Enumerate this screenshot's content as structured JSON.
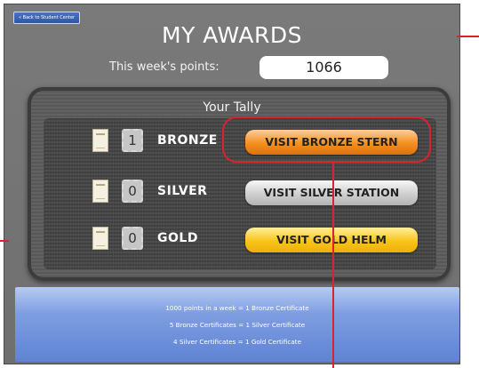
{
  "header": {
    "back_label": "« Back to Student Center",
    "title": "MY AWARDS"
  },
  "points": {
    "label": "This week's points:",
    "value": "1066"
  },
  "tally": {
    "title": "Your Tally",
    "rows": [
      {
        "count": "1",
        "tier": "BRONZE",
        "button": "VISIT BRONZE STERN"
      },
      {
        "count": "0",
        "tier": "SILVER",
        "button": "VISIT SILVER STATION"
      },
      {
        "count": "0",
        "tier": "GOLD",
        "button": "VISIT GOLD HELM"
      }
    ]
  },
  "info": {
    "lines": [
      "1000 points in a week = 1 Bronze Certificate",
      "5 Bronze Certificates = 1 Silver Certificate",
      "4 Silver Certificates = 1 Gold Certificate"
    ]
  },
  "colors": {
    "annotation_red": "#d9232e",
    "bronze": "#f3901f",
    "silver": "#cfcfcf",
    "gold": "#f8c41a"
  }
}
